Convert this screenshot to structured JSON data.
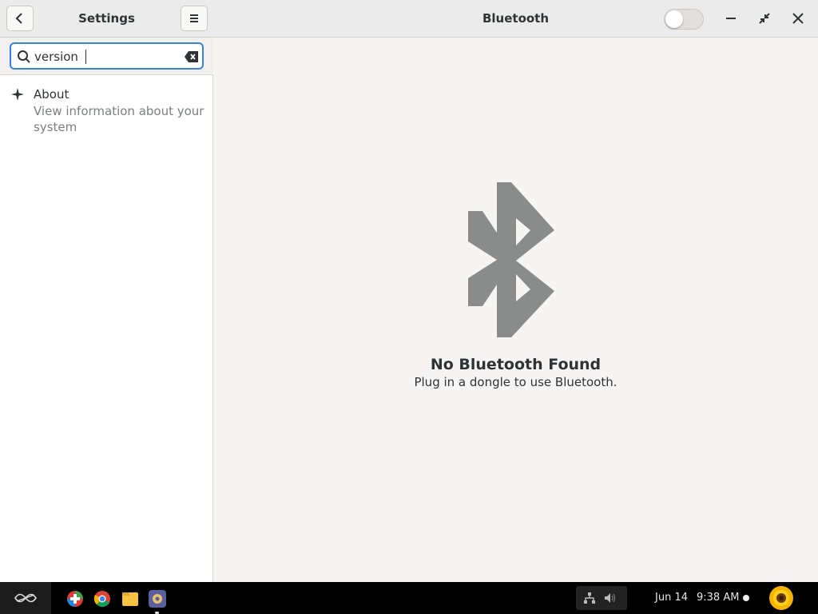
{
  "sidebar": {
    "title": "Settings",
    "search": {
      "value": "version",
      "placeholder": ""
    },
    "results": [
      {
        "title": "About",
        "description": "View information about your system",
        "icon": "sparkle-icon"
      }
    ]
  },
  "main": {
    "title": "Bluetooth",
    "bluetooth_enabled": false,
    "empty_state": {
      "title": "No Bluetooth Found",
      "subtitle": "Plug in a dongle to use Bluetooth."
    }
  },
  "taskbar": {
    "apps": [
      "app-center-icon",
      "chrome-icon",
      "files-icon",
      "settings-icon"
    ],
    "date": "Jun 14",
    "time": "9:38 AM"
  },
  "colors": {
    "accent": "#3584e4",
    "bluetooth_glyph": "#8a8c8c"
  }
}
